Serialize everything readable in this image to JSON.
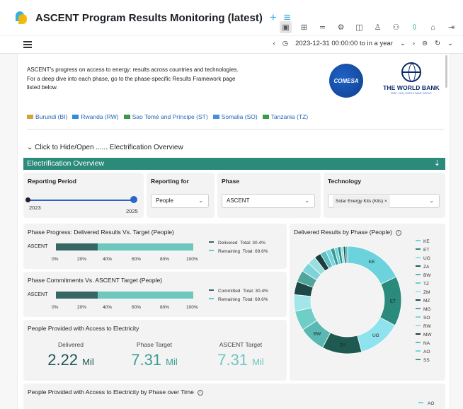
{
  "app": {
    "title": "ASCENT Program Results Monitoring (latest)",
    "add_icon": "+",
    "menu_icon": "≡"
  },
  "toolbar": {
    "icons": [
      "panel-icon",
      "folder-icon",
      "share-icon",
      "settings-icon",
      "book-icon",
      "user-icon",
      "users-icon",
      "sync-icon",
      "lock-icon",
      "logout-icon"
    ]
  },
  "timebar": {
    "back": "‹",
    "range": "2023-12-31 00:00:00 to in a year",
    "caret": "⌄",
    "forward": "›",
    "zoom": "⊖",
    "refresh": "↻"
  },
  "intro": {
    "text": "ASCENT's progress on access to energy: results across countries and technologies. For a deep dive into each phase, go to the phase-specific Results Framework page listed below.",
    "comesa_logo": "COMESA",
    "wb_logo_name": "THE WORLD BANK",
    "wb_logo_sub": "IBRD • IDA | WORLD BANK GROUP"
  },
  "countries": [
    {
      "label": "Burundi (BI)",
      "color": "#d6a23a"
    },
    {
      "label": "Rwanda (RW)",
      "color": "#2f8ed6"
    },
    {
      "label": "Sao Tomé and Príncipe (ST)",
      "color": "#3a9b47"
    },
    {
      "label": "Somalia (SO)",
      "color": "#4b8fd9"
    },
    {
      "label": "Tanzania (TZ)",
      "color": "#3a9b47"
    }
  ],
  "toggle_label": "⌄ Click to Hide/Open ...... Electrification Overview",
  "section": {
    "title": "Electrification Overview",
    "download_icon": "⇣"
  },
  "filters": {
    "reporting_period": {
      "label": "Reporting Period",
      "start": "2023",
      "end": "2025"
    },
    "reporting_for": {
      "label": "Reporting for",
      "value": "People"
    },
    "phase": {
      "label": "Phase",
      "value": "ASCENT"
    },
    "technology": {
      "label": "Technology",
      "chip": "Solar Energy Kits (Kits)",
      "chip_remove": "×"
    }
  },
  "progress": {
    "title": "Phase Progress: Delivered Results Vs. Target (People)",
    "category": "ASCENT",
    "legend": [
      {
        "label": "Delivered",
        "total": "Total: 30.4%",
        "color": "#376765"
      },
      {
        "label": "Remaining",
        "total": "Total: 69.6%",
        "color": "#6cc7bf"
      }
    ],
    "ticks": [
      "0%",
      "20%",
      "40%",
      "60%",
      "80%",
      "100%"
    ]
  },
  "commitments": {
    "title": "Phase Commitments Vs. ASCENT Target (People)",
    "category": "ASCENT",
    "legend": [
      {
        "label": "Committed",
        "total": "Total: 30.4%",
        "color": "#376765"
      },
      {
        "label": "Remaining",
        "total": "Total: 69.6%",
        "color": "#6cc7bf"
      }
    ],
    "ticks": [
      "0%",
      "20%",
      "40%",
      "60%",
      "80%",
      "100%"
    ]
  },
  "kpi": {
    "title": "People Provided with Access to Electricity",
    "items": [
      {
        "label": "Delivered",
        "number": "2.22",
        "unit": "Mil",
        "color": "#1f5553"
      },
      {
        "label": "Phase Target",
        "number": "7.31",
        "unit": "Mil",
        "color": "#3d9e96"
      },
      {
        "label": "ASCENT Target",
        "number": "7.31",
        "unit": "Mil",
        "color": "#6cc7bf"
      }
    ]
  },
  "donut": {
    "title": "Delivered Results by Phase (People)",
    "info_icon": "i"
  },
  "bottom": {
    "title": "People Provided with Access to Electricity by Phase over Time",
    "info_icon": "i",
    "legend": "AO"
  },
  "chart_data": [
    {
      "type": "bar",
      "title": "Phase Progress: Delivered Results Vs. Target (People)",
      "categories": [
        "ASCENT"
      ],
      "series": [
        {
          "name": "Delivered",
          "values": [
            30.4
          ],
          "color": "#376765"
        },
        {
          "name": "Remaining",
          "values": [
            69.6
          ],
          "color": "#6cc7bf"
        }
      ],
      "xlim": [
        0,
        100
      ]
    },
    {
      "type": "bar",
      "title": "Phase Commitments Vs. ASCENT Target (People)",
      "categories": [
        "ASCENT"
      ],
      "series": [
        {
          "name": "Committed",
          "values": [
            30.4
          ],
          "color": "#376765"
        },
        {
          "name": "Remaining",
          "values": [
            69.6
          ],
          "color": "#6cc7bf"
        }
      ],
      "xlim": [
        0,
        100
      ]
    },
    {
      "type": "pie",
      "title": "Delivered Results by Phase (People)",
      "legend": [
        {
          "name": "KE",
          "color": "#6cd3dc"
        },
        {
          "name": "ET",
          "color": "#2a8a7c"
        },
        {
          "name": "UG",
          "color": "#8fe3ee"
        },
        {
          "name": "ZA",
          "color": "#1f5a52"
        },
        {
          "name": "BW",
          "color": "#5ab8b2"
        },
        {
          "name": "TZ",
          "color": "#6fcfc8"
        },
        {
          "name": "ZM",
          "color": "#a3e6ea"
        },
        {
          "name": "MZ",
          "color": "#1e4747"
        },
        {
          "name": "MG",
          "color": "#4fa49c"
        },
        {
          "name": "SO",
          "color": "#7fd4dc"
        },
        {
          "name": "RW",
          "color": "#9adfe0"
        },
        {
          "name": "MW",
          "color": "#1c3e3e"
        },
        {
          "name": "NA",
          "color": "#5dbfc4"
        },
        {
          "name": "AO",
          "color": "#74d6df"
        },
        {
          "name": "SS",
          "color": "#3a9b93"
        }
      ],
      "slice_labels": [
        "KE",
        "ET",
        "UG",
        "ZA",
        "BW"
      ],
      "values": [
        18,
        15,
        13,
        12,
        8,
        6,
        5,
        4,
        3.5,
        3,
        2.5,
        2,
        1.8,
        1.5,
        1.2,
        1,
        0.9,
        0.8,
        0.7,
        0.6
      ]
    }
  ]
}
